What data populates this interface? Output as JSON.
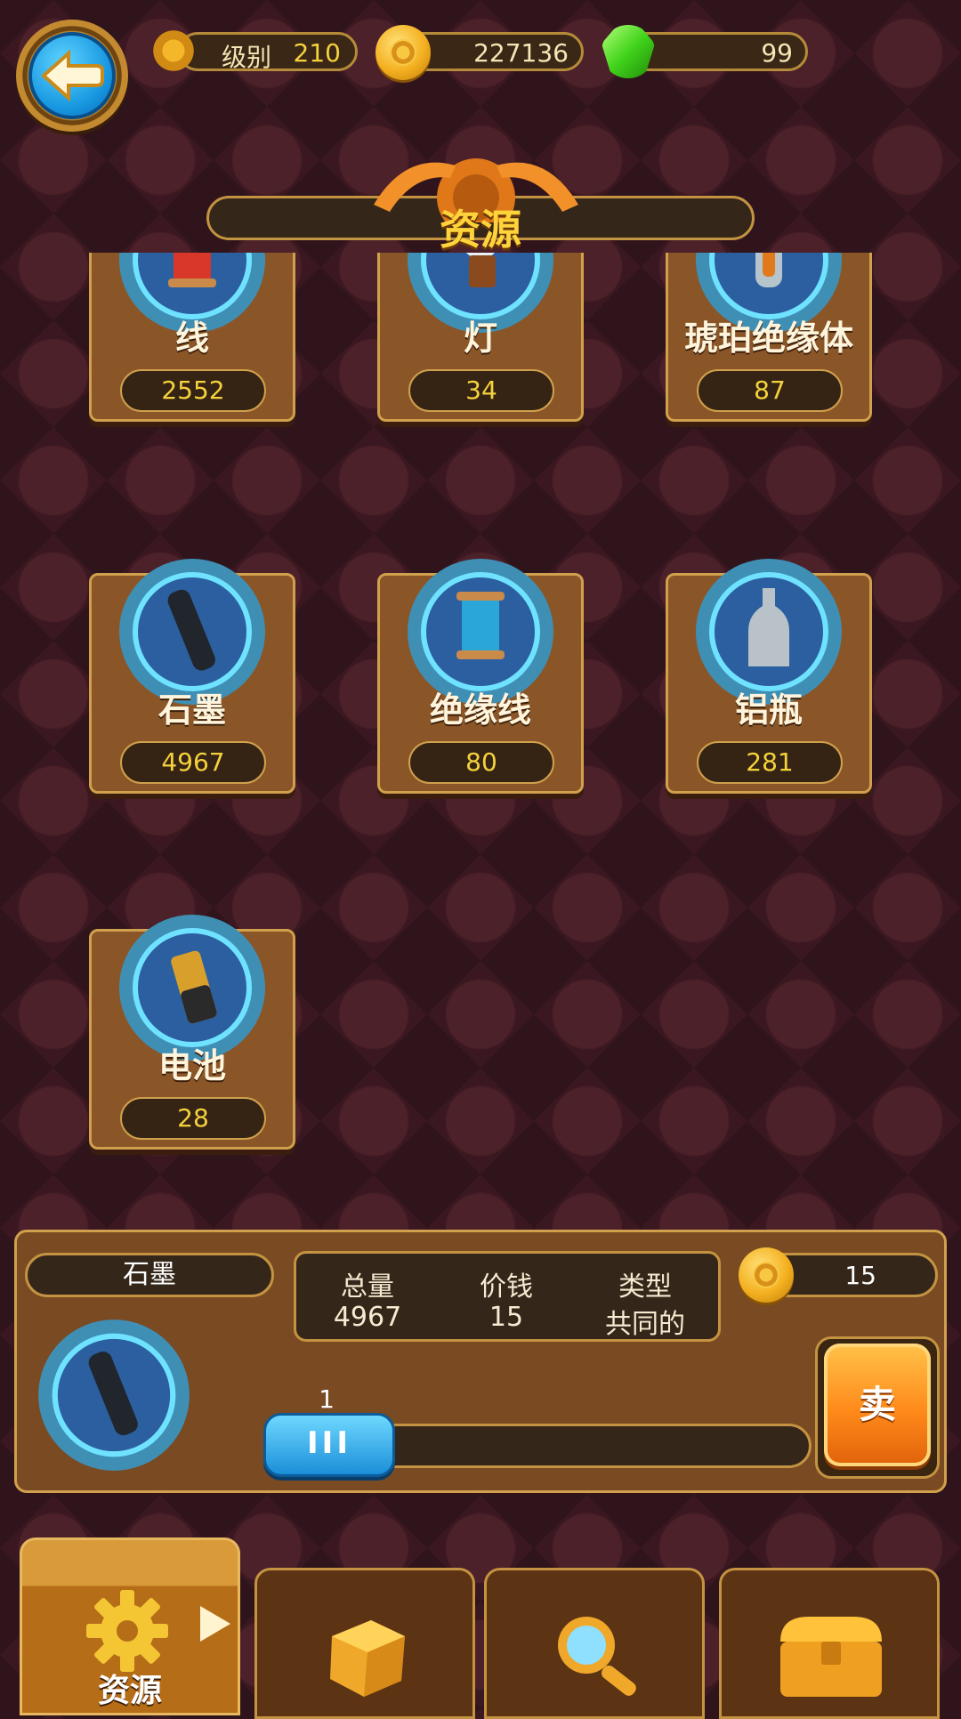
{
  "hud": {
    "level_label": "级别",
    "level_value": "210",
    "coins": "227136",
    "gems": "99"
  },
  "title": "资源",
  "resources": [
    {
      "name": "线",
      "count": "2552",
      "icon": "thread-spool-red-icon"
    },
    {
      "name": "灯",
      "count": "34",
      "icon": "light-bulb-icon"
    },
    {
      "name": "琥珀绝缘体",
      "count": "87",
      "icon": "amber-insulator-icon"
    },
    {
      "name": "石墨",
      "count": "4967",
      "icon": "graphite-rod-icon"
    },
    {
      "name": "绝缘线",
      "count": "80",
      "icon": "insulated-wire-spool-icon"
    },
    {
      "name": "铝瓶",
      "count": "281",
      "icon": "aluminum-bottle-icon"
    },
    {
      "name": "电池",
      "count": "28",
      "icon": "battery-icon"
    }
  ],
  "detail": {
    "name": "石墨",
    "total_label": "总量",
    "total_value": "4967",
    "price_label": "价钱",
    "price_value": "15",
    "type_label": "类型",
    "type_value": "共同的",
    "sell_price": "15",
    "quantity": "1",
    "slider_knob": "III",
    "sell_label": "卖"
  },
  "tabs": [
    {
      "label": "资源",
      "icon": "gear-icon",
      "active": true
    },
    {
      "label": "",
      "icon": "dice-icon",
      "active": false
    },
    {
      "label": "",
      "icon": "magnifier-icon",
      "active": false
    },
    {
      "label": "",
      "icon": "treasure-chest-icon",
      "active": false
    }
  ],
  "colors": {
    "background": "#3b1821",
    "card": "#8a5628",
    "gold_text": "#f5d23c",
    "accent_orange": "#ff8a1a",
    "accent_blue": "#1a8fd8"
  }
}
